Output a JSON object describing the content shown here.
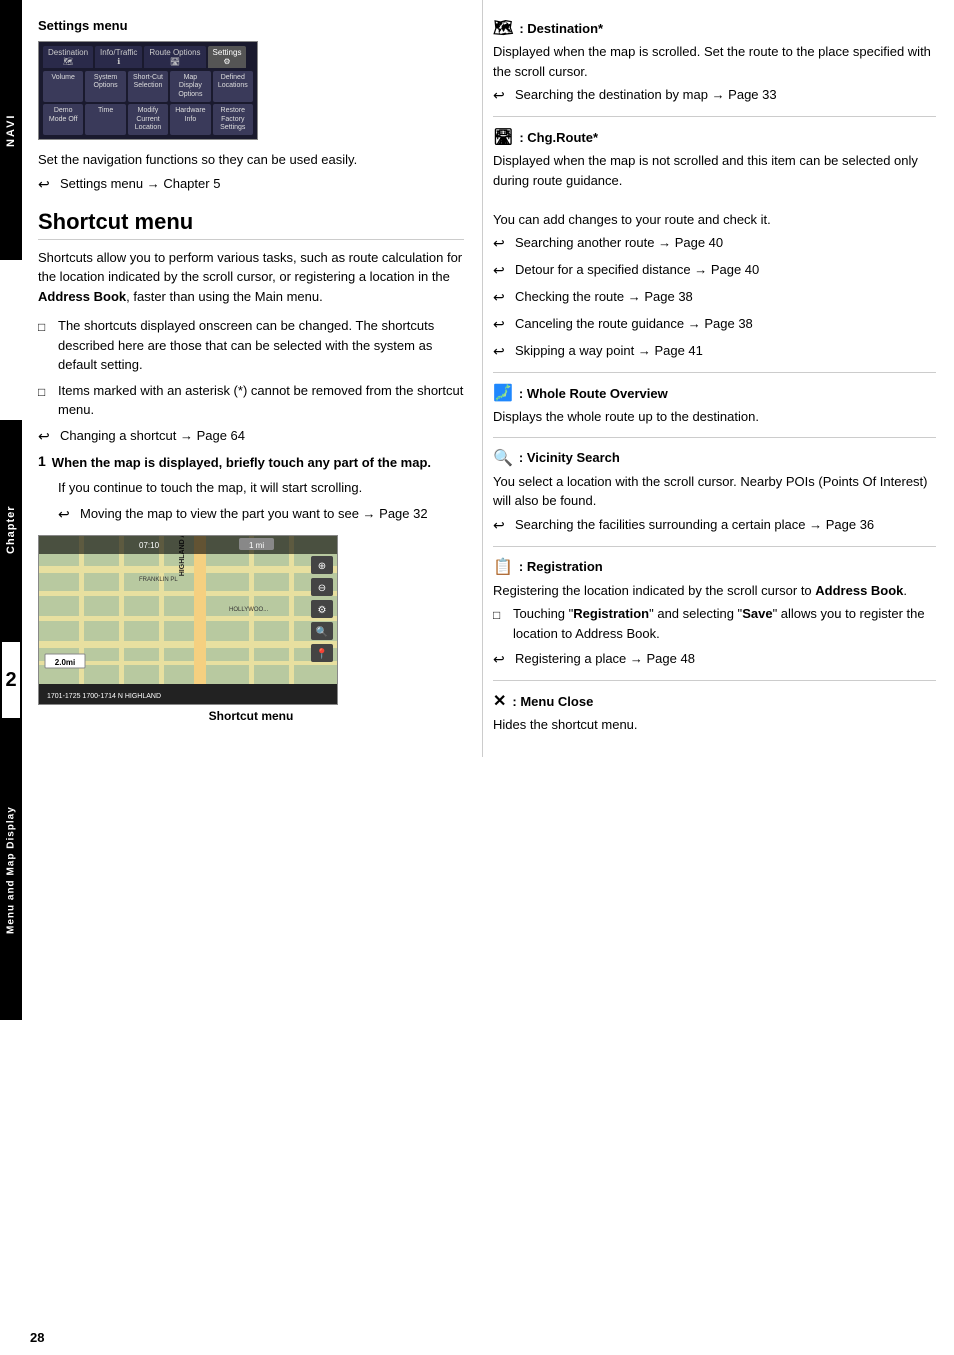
{
  "side_labels": {
    "navi": "NAVI",
    "chapter": "Chapter",
    "chapter_num": "2",
    "menu": "Menu and Map Display"
  },
  "left_col": {
    "settings_menu": {
      "title": "Settings menu",
      "tabs": [
        "Destination",
        "Info/Traffic",
        "Route Options",
        "Settings"
      ],
      "buttons_row1": [
        "Volume",
        "System Options",
        "Short-Cut Selection",
        "Map Display Options",
        "Defined Locations"
      ],
      "buttons_row2": [
        "Demo Mode Off",
        "Time",
        "Modify Current Location",
        "Hardware Info",
        "Restore Factory Settings"
      ]
    },
    "settings_desc": "Set the navigation functions so they can be used easily.",
    "settings_link": "Settings menu → Chapter 5",
    "shortcut_title": "Shortcut menu",
    "shortcut_desc": "Shortcuts allow you to perform various tasks, such as route calculation for the location indicated by the scroll cursor, or registering a location in the Address Book, faster than using the Main menu.",
    "bullets": [
      "The shortcuts displayed onscreen can be changed. The shortcuts described here are those that can be selected with the system as default setting.",
      "Items marked with an asterisk (*) cannot be removed from the shortcut menu."
    ],
    "changing_shortcut": "Changing a shortcut → Page 64",
    "step1_heading": "When the map is displayed, briefly touch any part of the map.",
    "step1_body": "If you continue to touch the map, it will start scrolling.",
    "step1_link": "Moving the map to view the part you want to see → Page 32",
    "map_caption": "Shortcut menu"
  },
  "right_col": {
    "sections": [
      {
        "id": "destination",
        "icon": "🗺",
        "title": ": Destination*",
        "body": "Displayed when the map is scrolled. Set the route to the place specified with the scroll cursor.",
        "bullets": [
          "Searching the destination by map → Page 33"
        ]
      },
      {
        "id": "chg-route",
        "icon": "🛣",
        "title": ": Chg.Route*",
        "body": "Displayed when the map is not scrolled and this item can be selected only during route guidance.\nYou can add changes to your route and check it.",
        "bullets": [
          "Searching another route → Page 40",
          "Detour for a specified distance → Page 40",
          "Checking the route → Page 38",
          "Canceling the route guidance → Page 38",
          "Skipping a way point → Page 41"
        ]
      },
      {
        "id": "whole-route",
        "icon": "🗾",
        "title": ": Whole Route Overview",
        "body": "Displays the whole route up to the destination.",
        "bullets": []
      },
      {
        "id": "vicinity-search",
        "icon": "🔍",
        "title": ": Vicinity Search",
        "body": "You select a location with the scroll cursor. Nearby POIs (Points Of Interest) will also be found.",
        "bullets": [
          "Searching the facilities surrounding a certain place → Page 36"
        ]
      },
      {
        "id": "registration",
        "icon": "📋",
        "title": ": Registration",
        "body": "Registering the location indicated by the scroll cursor to Address Book.",
        "bullets_special": [
          {
            "type": "square",
            "text": "Touching \"Registration\" and selecting \"Save\" allows you to register the location to Address Book."
          },
          {
            "type": "arrow",
            "text": "Registering a place → Page 48"
          }
        ]
      },
      {
        "id": "menu-close",
        "icon": "✕",
        "title": ": Menu Close",
        "body": "Hides the shortcut menu.",
        "bullets": []
      }
    ]
  },
  "page_number": "28"
}
